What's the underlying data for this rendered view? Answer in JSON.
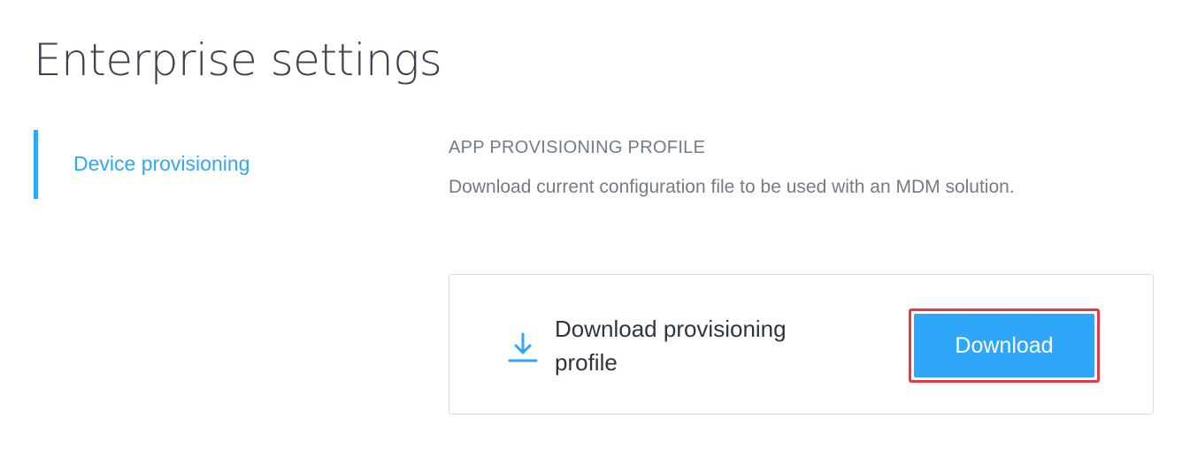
{
  "header": {
    "title": "Enterprise settings"
  },
  "sidebar": {
    "items": [
      {
        "label": "Device provisioning",
        "active": true
      }
    ]
  },
  "main": {
    "section": {
      "heading": "APP PROVISIONING PROFILE",
      "description": "Download current configuration file to be used with an MDM solution."
    },
    "card": {
      "icon": "download-icon",
      "label": "Download provisioning profile",
      "button_label": "Download"
    }
  },
  "colors": {
    "accent": "#2ea7f8",
    "title_text": "#3a4250",
    "muted_text": "#737b87",
    "highlight_border": "#e63946"
  }
}
